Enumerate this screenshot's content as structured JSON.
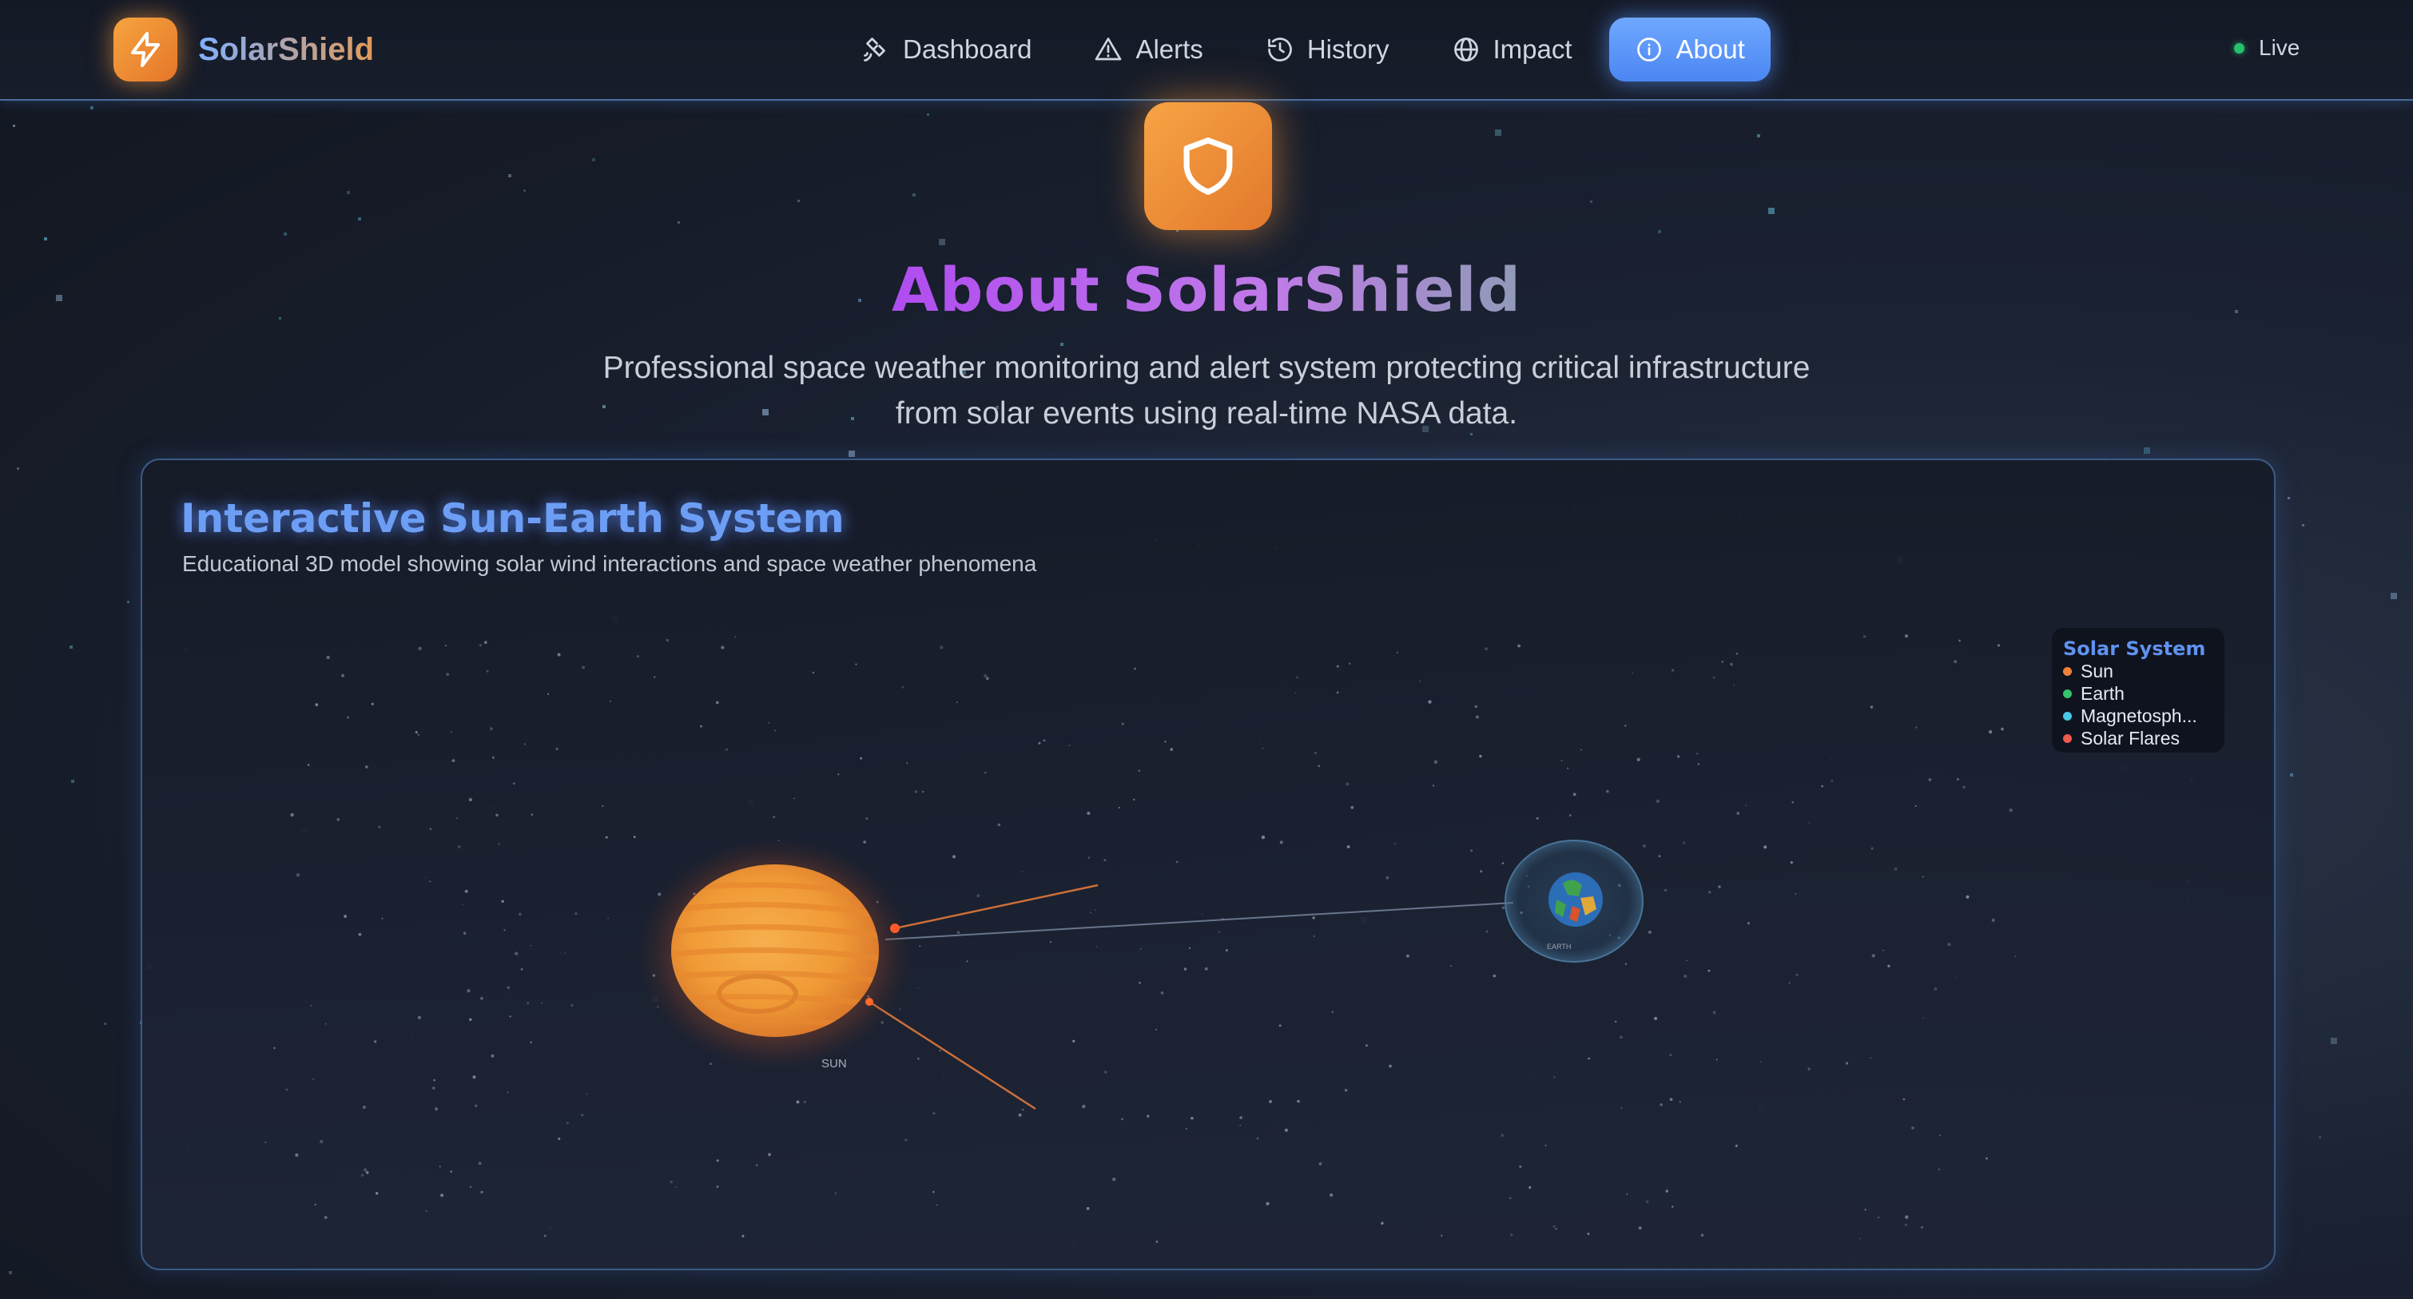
{
  "brand": {
    "name": "SolarShield",
    "icon": "lightning-bolt-icon"
  },
  "nav": {
    "items": [
      {
        "label": "Dashboard",
        "icon": "satellite-icon",
        "active": false
      },
      {
        "label": "Alerts",
        "icon": "warning-triangle-icon",
        "active": false
      },
      {
        "label": "History",
        "icon": "history-clock-icon",
        "active": false
      },
      {
        "label": "Impact",
        "icon": "globe-icon",
        "active": false
      },
      {
        "label": "About",
        "icon": "info-icon",
        "active": true
      }
    ]
  },
  "status": {
    "label": "Live",
    "color": "#27c06b"
  },
  "hero": {
    "icon": "shield-icon",
    "title": "About SolarShield",
    "subtitle_line1": "Professional space weather monitoring and alert system protecting critical infrastructure",
    "subtitle_line2": "from solar events using real-time NASA data."
  },
  "model_card": {
    "title": "Interactive Sun-Earth System",
    "subtitle": "Educational 3D model showing solar wind interactions and space weather phenomena",
    "sun_label": "SUN",
    "earth_label": "EARTH",
    "legend": {
      "title": "Solar System",
      "items": [
        {
          "label": "Sun",
          "color": "#f0803a"
        },
        {
          "label": "Earth",
          "color": "#34c26a"
        },
        {
          "label": "Magnetosph...",
          "color": "#48c7e6"
        },
        {
          "label": "Solar Flares",
          "color": "#ef5a4c"
        }
      ]
    }
  },
  "colors": {
    "accent": "#5b93f5",
    "brand_orange": "#f29a3c",
    "title_purple": "#b04cf0",
    "nav_active": "#5b93f5"
  }
}
